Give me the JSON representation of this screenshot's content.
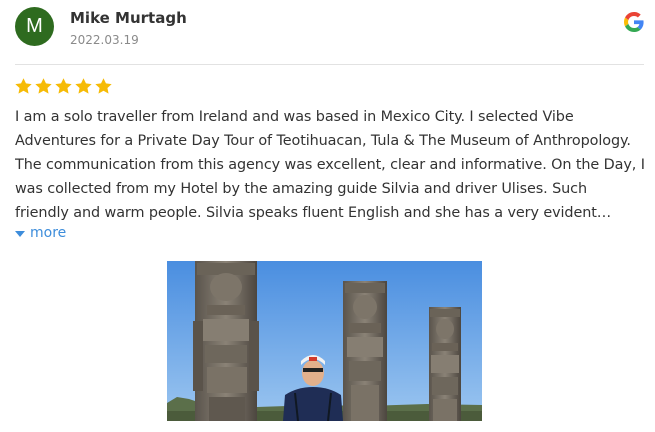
{
  "review": {
    "reviewer_initial": "M",
    "reviewer_name": "Mike Murtagh",
    "date": "2022.03.19",
    "rating": 5,
    "rating_max": 5,
    "text": "I am a solo traveller from Ireland and was based in Mexico City. I selected Vibe Adventures for a Private Day Tour of Teotihuacan, Tula & The Museum of Anthropology. The communication from this agency was excellent, clear and informative. On the Day, I was collected from my Hotel by the amazing guide Silvia and driver Ulises. Such friendly and warm people. Silvia speaks fluent English and she has a very evident passion for History....",
    "more_label": "more",
    "source_icon": "google-g-icon",
    "photo_icon": "review-photo"
  },
  "colors": {
    "avatar_bg": "#2e6b1f",
    "star": "#f6bb06",
    "link": "#3d8ddb",
    "text": "#333333",
    "date": "#8a8a8a"
  }
}
